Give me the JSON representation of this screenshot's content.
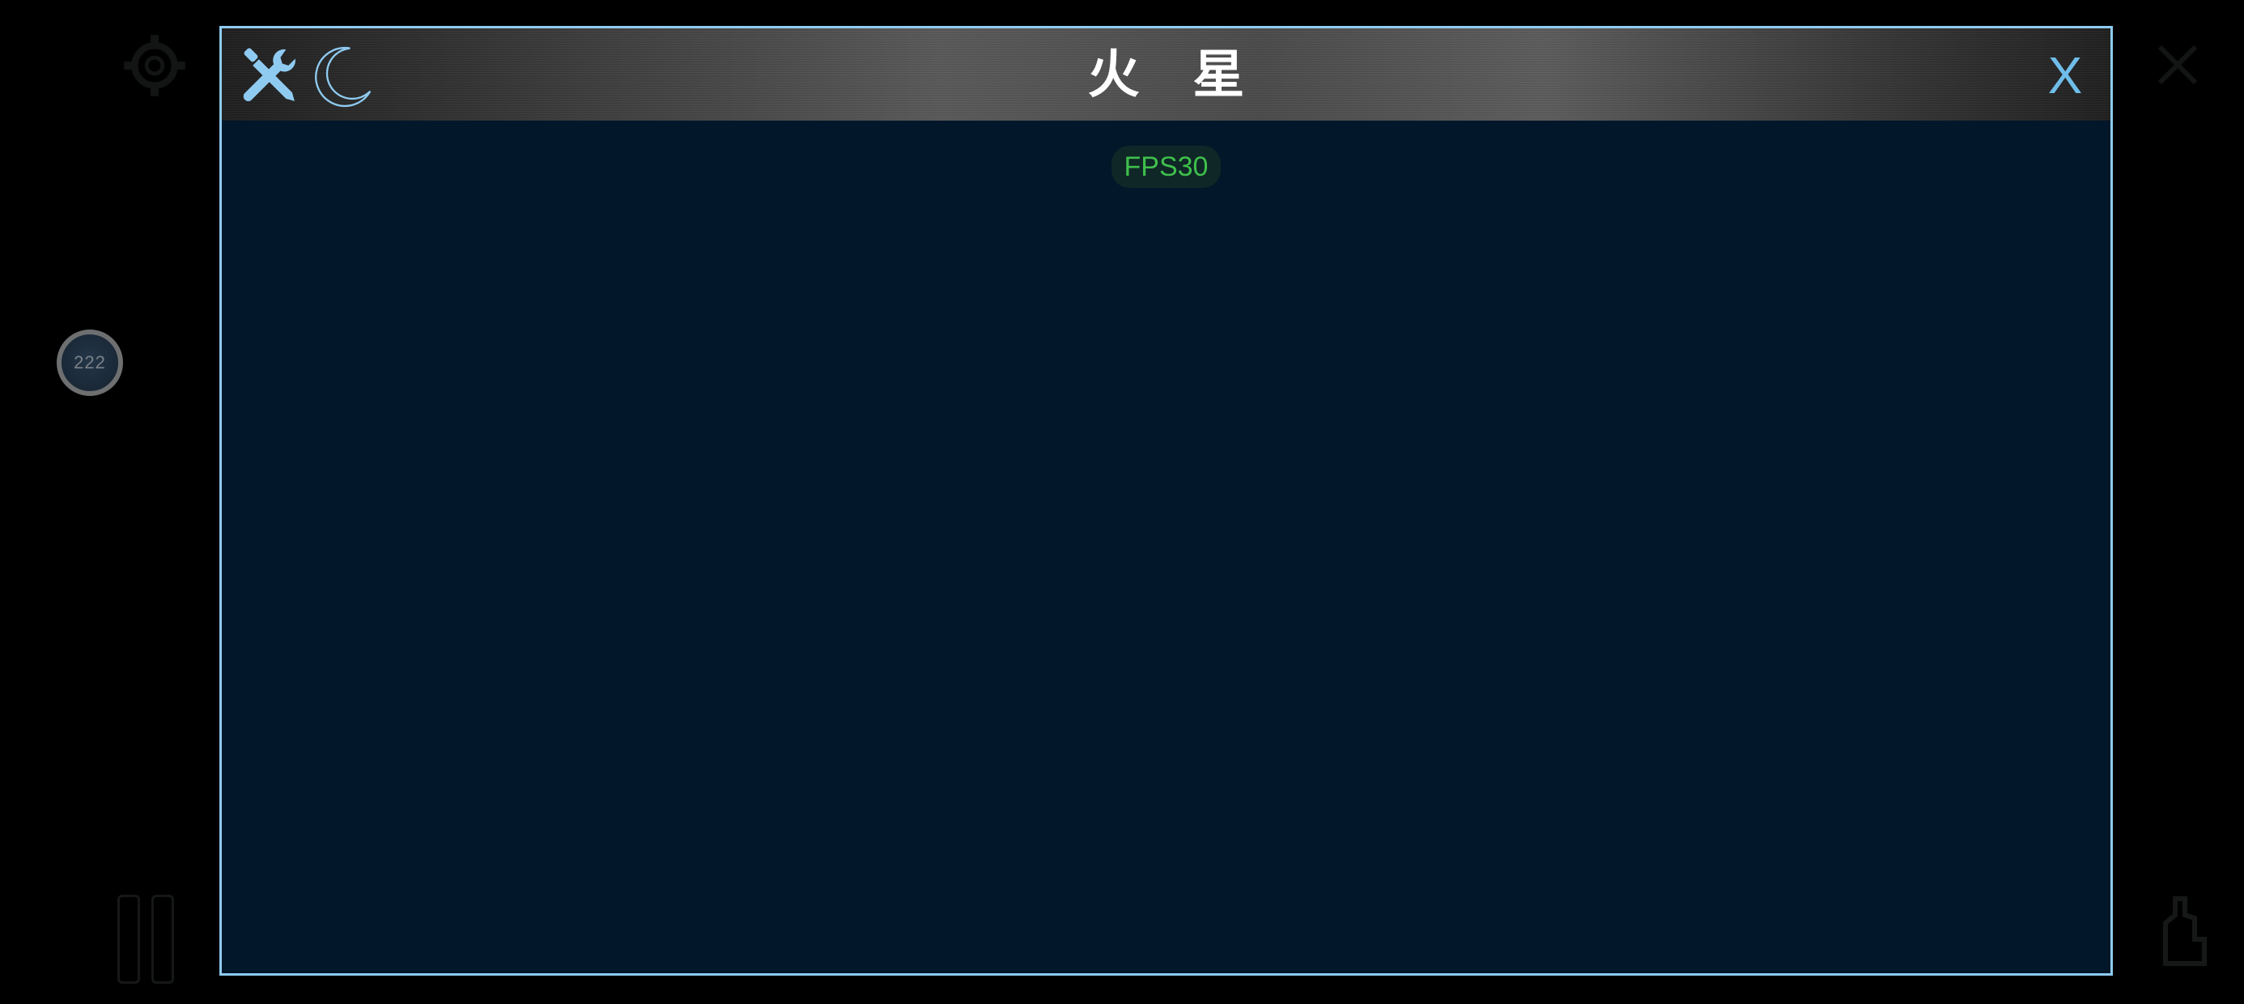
{
  "dialog": {
    "title": "火 星",
    "close_label": "X",
    "fps_label": "FPS30",
    "border_color": "#8fcbf1",
    "background_color": "#02172a",
    "accent_color": "#6fbde9",
    "fps_color": "#3fbf4c"
  },
  "side_badge": {
    "label": "222"
  },
  "icons": {
    "tools": "tools-icon",
    "moon": "moon-icon",
    "gear": "gear-icon",
    "pause": "pause-icon",
    "close": "close-icon"
  }
}
